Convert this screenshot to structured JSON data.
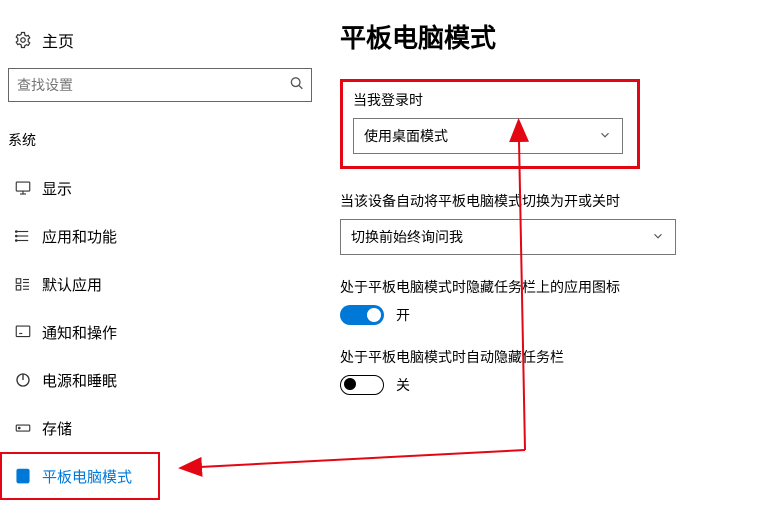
{
  "sidebar": {
    "home_label": "主页",
    "search_placeholder": "查找设置",
    "section_label": "系统",
    "items": [
      {
        "label": "显示"
      },
      {
        "label": "应用和功能"
      },
      {
        "label": "默认应用"
      },
      {
        "label": "通知和操作"
      },
      {
        "label": "电源和睡眠"
      },
      {
        "label": "存储"
      },
      {
        "label": "平板电脑模式"
      }
    ]
  },
  "main": {
    "title": "平板电脑模式",
    "block1": {
      "label": "当我登录时",
      "value": "使用桌面模式"
    },
    "block2": {
      "label": "当该设备自动将平板电脑模式切换为开或关时",
      "value": "切换前始终询问我"
    },
    "block3": {
      "label": "处于平板电脑模式时隐藏任务栏上的应用图标",
      "toggle_state": "on",
      "toggle_text": "开"
    },
    "block4": {
      "label": "处于平板电脑模式时自动隐藏任务栏",
      "toggle_state": "off",
      "toggle_text": "关"
    }
  },
  "annotations": {
    "highlight_box_color": "#e30613"
  }
}
